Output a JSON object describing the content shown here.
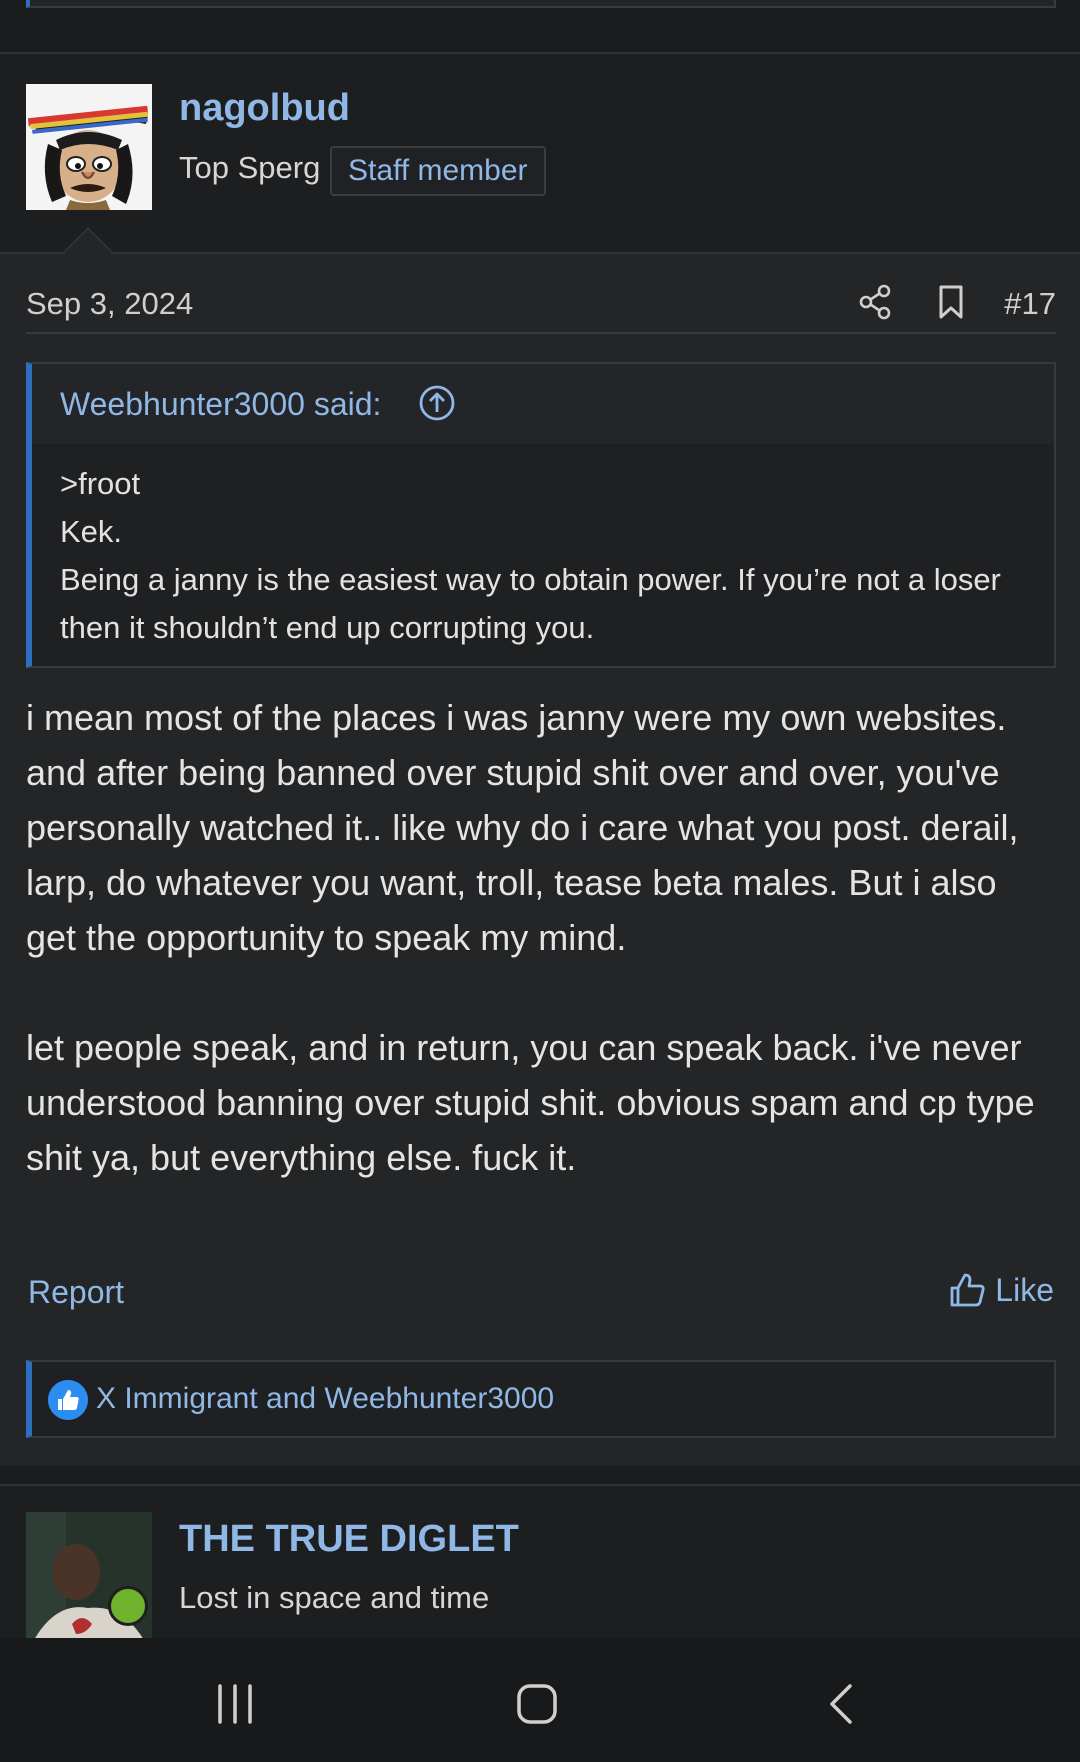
{
  "post": {
    "username": "nagolbud",
    "user_title": "Top Sperg",
    "staff_badge": "Staff member",
    "date": "Sep 3, 2024",
    "post_number": "#17",
    "share_icon": "share-icon",
    "bookmark_icon": "bookmark-icon",
    "quote": {
      "author": "Weebhunter3000 said:",
      "lines": [
        ">froot",
        "Kek.",
        "Being a janny is the easiest way to obtain power. If you’re not a loser then it shouldn’t end up corrupting you."
      ]
    },
    "message": [
      "i mean most of the places i was janny were my own websites. and after being banned over stupid shit over and over, you've personally watched it.. like why do i care what you post. derail, larp, do whatever you want, troll, tease beta males. But i also get the opportunity to speak my mind.",
      "let people speak, and in return, you can speak back. i've never understood banning over stupid shit. obvious spam and cp type shit ya, but everything else. fuck it."
    ],
    "report_label": "Report",
    "like_label": "Like",
    "reactions_text": "X Immigrant and Weebhunter3000"
  },
  "next_post": {
    "username": "THE TRUE DIGLET",
    "user_title": "Lost in space and time"
  },
  "colors": {
    "link": "#8fb8e6",
    "accent": "#2f6fbf",
    "background": "#242526",
    "header_background": "#1d1e20",
    "online": "#6fb22e"
  },
  "nav": {
    "recent_icon": "recent-apps-icon",
    "home_icon": "home-icon",
    "back_icon": "back-icon"
  }
}
